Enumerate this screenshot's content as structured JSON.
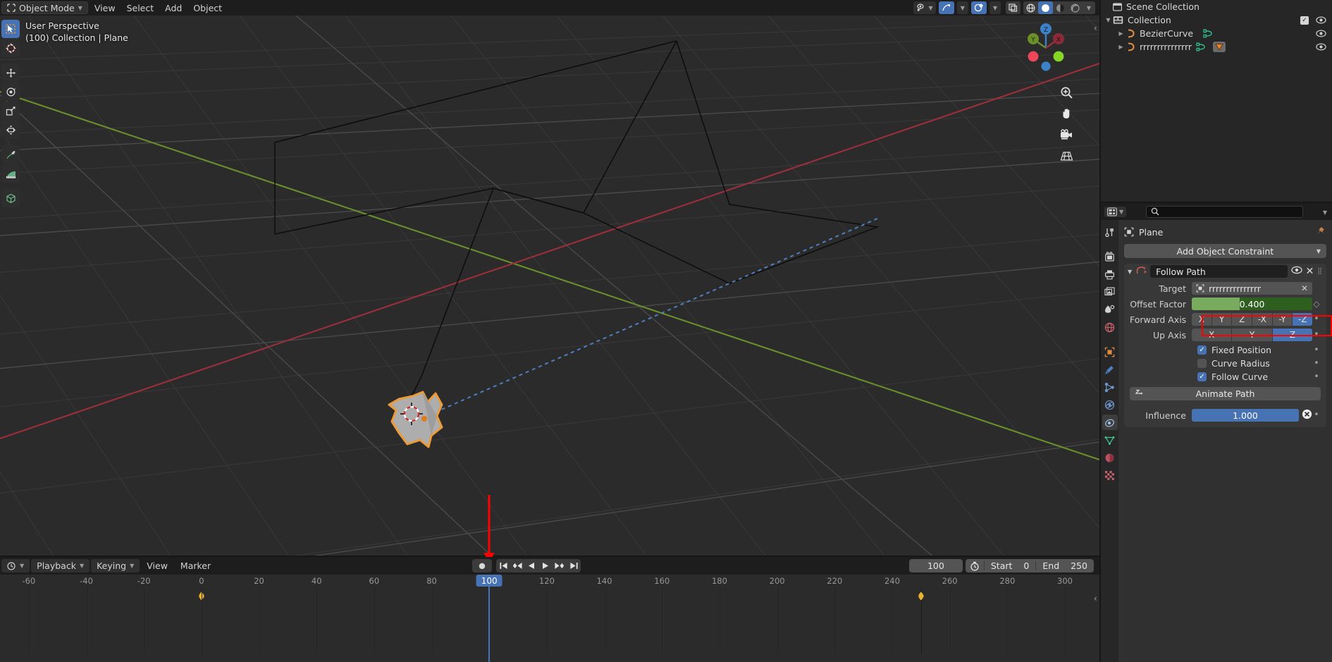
{
  "app": "Blender",
  "viewport": {
    "header": {
      "mode": "Object Mode",
      "menus": [
        "View",
        "Select",
        "Add",
        "Object"
      ],
      "right_icons": [
        {
          "name": "visibility-icon",
          "label": "Show Gizmo"
        },
        {
          "name": "gizmo-icon",
          "label": "Gizmos"
        },
        {
          "name": "overlays-icon",
          "label": "Overlays"
        },
        {
          "name": "xray-icon",
          "label": "Toggle X-Ray"
        },
        {
          "name": "shading-wireframe-icon",
          "label": "Wireframe"
        },
        {
          "name": "shading-solid-icon",
          "label": "Solid"
        },
        {
          "name": "shading-material-icon",
          "label": "Material Preview"
        },
        {
          "name": "shading-rendered-icon",
          "label": "Rendered"
        }
      ]
    },
    "info": {
      "line1": "User Perspective",
      "line2": "(100) Collection | Plane"
    },
    "tools": [
      {
        "name": "tweak-tool",
        "label": "Tweak",
        "active": true
      },
      {
        "name": "cursor-tool",
        "label": "Cursor",
        "active": false
      },
      {
        "name": "move-tool",
        "label": "Move",
        "active": false
      },
      {
        "name": "rotate-tool",
        "label": "Rotate",
        "active": false
      },
      {
        "name": "scale-tool",
        "label": "Scale",
        "active": false
      },
      {
        "name": "transform-tool",
        "label": "Transform",
        "active": false
      },
      {
        "name": "annotate-tool",
        "label": "Annotate",
        "active": false
      },
      {
        "name": "measure-tool",
        "label": "Measure",
        "active": false
      },
      {
        "name": "add-cube-tool",
        "label": "Add Cube",
        "active": false
      }
    ],
    "gizmo": {
      "axes": [
        "Z",
        "Y",
        "X"
      ],
      "colors": {
        "x": "#cc4254",
        "y": "#7eb53b",
        "z": "#3d81c6"
      }
    },
    "nav_buttons": [
      {
        "name": "zoom-icon",
        "label": "Zoom"
      },
      {
        "name": "pan-hand-icon",
        "label": "Move View"
      },
      {
        "name": "camera-icon",
        "label": "Camera View"
      },
      {
        "name": "ortho-persp-icon",
        "label": "Toggle Perspective"
      }
    ],
    "scene": {
      "selected_object": "Plane",
      "axis_colors": {
        "x_axis": "#9c2f3c",
        "y_axis": "#6b8f29"
      },
      "path_color": "#4f7fbe",
      "selection_outline": "#ed9b38"
    }
  },
  "outliner": {
    "title": "Scene Collection",
    "rows": [
      {
        "label": "Collection",
        "indent": 0,
        "disclosure": "down",
        "icon": "collection-icon",
        "checkbox": true,
        "eye": true
      },
      {
        "label": "BezierCurve",
        "indent": 1,
        "disclosure": "right",
        "icon": "curve-icon",
        "checkbox": false,
        "eye": true
      },
      {
        "label": "rrrrrrrrrrrrrrr",
        "indent": 1,
        "disclosure": "right",
        "icon": "curve-icon",
        "checkbox": false,
        "eye": true,
        "constraint_badge": true
      }
    ]
  },
  "properties": {
    "search_placeholder": "",
    "breadcrumb": "Plane",
    "add_constraint_label": "Add Object Constraint",
    "tabs": [
      {
        "name": "tool-tab",
        "label": "Tool",
        "active": false
      },
      {
        "name": "render-tab",
        "label": "Render",
        "active": false
      },
      {
        "name": "output-tab",
        "label": "Output",
        "active": false
      },
      {
        "name": "view-layer-tab",
        "label": "View Layer",
        "active": false
      },
      {
        "name": "scene-tab",
        "label": "Scene",
        "active": false
      },
      {
        "name": "world-tab",
        "label": "World",
        "active": false
      },
      {
        "name": "object-tab",
        "label": "Object",
        "active": false
      },
      {
        "name": "modifiers-tab",
        "label": "Modifiers",
        "active": false
      },
      {
        "name": "particles-tab",
        "label": "Particles",
        "active": false
      },
      {
        "name": "physics-tab",
        "label": "Physics",
        "active": false
      },
      {
        "name": "constraints-tab",
        "label": "Object Constraints",
        "active": true
      },
      {
        "name": "data-tab",
        "label": "Object Data",
        "active": false
      },
      {
        "name": "material-tab",
        "label": "Material",
        "active": false
      },
      {
        "name": "texture-tab",
        "label": "Texture",
        "active": false
      }
    ],
    "constraint": {
      "name": "Follow Path",
      "icon": "follow-path-icon",
      "target_label": "Target",
      "target_value": "rrrrrrrrrrrrrrr",
      "offset_factor_label": "Offset Factor",
      "offset_factor_value": "0.400",
      "offset_factor_pct": 40,
      "forward_axis_label": "Forward Axis",
      "forward_axis_options": [
        "X",
        "Y",
        "Z",
        "-X",
        "-Y",
        "-Z"
      ],
      "forward_axis_selected": "-Z",
      "up_axis_label": "Up Axis",
      "up_axis_options": [
        "X",
        "Y",
        "Z"
      ],
      "up_axis_selected": "Z",
      "checkboxes": [
        {
          "label": "Fixed Position",
          "checked": true
        },
        {
          "label": "Curve Radius",
          "checked": false
        },
        {
          "label": "Follow Curve",
          "checked": true
        }
      ],
      "animate_path_label": "Animate Path",
      "influence_label": "Influence",
      "influence_value": "1.000",
      "influence_pct": 100
    },
    "highlight_color": "#fd0000"
  },
  "timeline": {
    "menus": [
      "Playback",
      "Keying",
      "View",
      "Marker"
    ],
    "transport": [
      {
        "name": "jump-start-icon",
        "label": "Jump to Start"
      },
      {
        "name": "prev-keyframe-icon",
        "label": "Jump to Previous Keyframe"
      },
      {
        "name": "play-reverse-icon",
        "label": "Play Reverse"
      },
      {
        "name": "play-icon",
        "label": "Play"
      },
      {
        "name": "next-keyframe-icon",
        "label": "Jump to Next Keyframe"
      },
      {
        "name": "jump-end-icon",
        "label": "Jump to End"
      }
    ],
    "record_label": "Auto Keying",
    "current_frame": "100",
    "start_label": "Start",
    "start_value": "0",
    "end_label": "End",
    "end_value": "250",
    "ruler_ticks": [
      "-60",
      "-40",
      "-20",
      "0",
      "20",
      "40",
      "60",
      "80",
      "100",
      "120",
      "140",
      "160",
      "180",
      "200",
      "220",
      "240",
      "260",
      "280",
      "300"
    ],
    "keyframes": [
      0,
      250
    ],
    "playhead_frame": 100,
    "playhead_color": "#4772b3",
    "keyframe_color": "#e8b331"
  },
  "annotation": {
    "arrow_color": "#fd0000",
    "arrow_target": "playhead-frame-100"
  }
}
